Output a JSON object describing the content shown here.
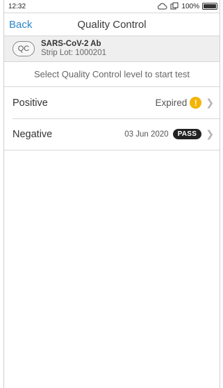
{
  "status_bar": {
    "time": "12:32",
    "battery": "100%",
    "icons": [
      "cloud-icon",
      "sync-icon",
      "battery-icon"
    ]
  },
  "nav": {
    "back_label": "Back",
    "title": "Quality Control"
  },
  "info": {
    "badge": "QC",
    "title": "SARS-CoV-2 Ab",
    "subtitle": "Strip Lot: 1000201"
  },
  "instruction": "Select Quality Control level to start test",
  "rows": [
    {
      "label": "Positive",
      "status": "Expired",
      "indicator": "warning-icon"
    },
    {
      "label": "Negative",
      "date": "03 Jun 2020",
      "badge": "PASS"
    }
  ],
  "colors": {
    "link": "#2b86c9",
    "warning": "#f4b400",
    "pass_badge": "#222222"
  }
}
